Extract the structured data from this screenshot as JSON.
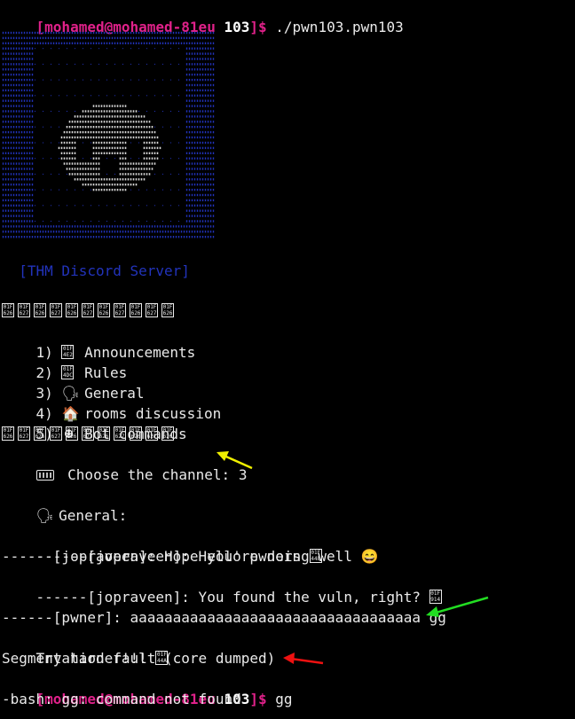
{
  "prompt": {
    "user_host": "[mohamed@mohamed-81eu",
    "dir": "103",
    "suffix": "]$",
    "colors": {
      "user": "#e0218a",
      "dir": "#ffffff"
    }
  },
  "commands": {
    "first": " ./pwn103.pwn103",
    "second": " gg"
  },
  "banner": {
    "server_name": "  [THM Discord Server]",
    "art_color": "#2233bb"
  },
  "menu": {
    "separator_count": 11,
    "items": [
      {
        "num": "1)",
        "icon": "megaphone-icon",
        "label": "Announcements"
      },
      {
        "num": "2)",
        "icon": "rules-icon",
        "label": "Rules"
      },
      {
        "num": "3)",
        "icon": "speaking-head-icon",
        "label": "General"
      },
      {
        "num": "4)",
        "icon": "house-icon",
        "label": "rooms discussion"
      },
      {
        "num": "5)",
        "icon": "bot-icon",
        "label": "Bot commands"
      }
    ],
    "choose_prompt": " Choose the channel: 3"
  },
  "channel": {
    "title": " General:"
  },
  "messages": [
    {
      "text": "------[jopraveen]: Hello pwners ",
      "icon": "wave-icon"
    },
    {
      "text": "------[jopraveen]: Hope you're doing well 😄",
      "icon": ""
    },
    {
      "text": "------[jopraveen]: You found the vuln, right? ",
      "icon": "thinking-icon"
    }
  ],
  "input_line": "------[pwner]: aaaaaaaaaaaaaaaaaaaaaaaaaaaaaaaaaa gg",
  "responses": {
    "try_harder": "Try harder!!! ",
    "segfault": "Segmentation fault (core dumped)",
    "bash_error": "-bash: gg: command not found"
  },
  "annotations": {
    "yellow": "#f0f000",
    "green": "#22dd22",
    "red": "#ee1111"
  }
}
